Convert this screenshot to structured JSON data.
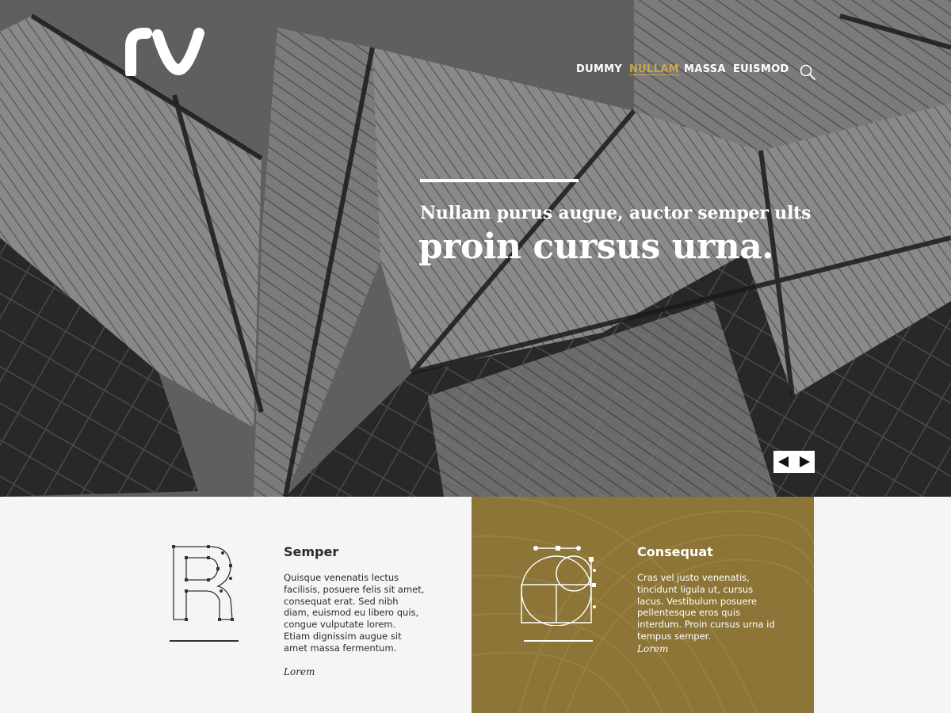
{
  "nav": {
    "items": [
      {
        "label": "DUMMY"
      },
      {
        "label": "NULLAM"
      },
      {
        "label": "MASSA"
      },
      {
        "label": "EUISMOD"
      }
    ],
    "active_index": 1,
    "search_icon": "search-icon"
  },
  "hero": {
    "subtitle": "Nullam purus augue, auctor semper ults",
    "title": "proin cursus urna."
  },
  "cards": [
    {
      "title": "Semper",
      "text": "Quisque venenatis lectus facilisis, posuere felis sit amet, consequat erat. Sed nibh diam, euismod eu libero quis, congue vulputate lorem. Etiam dignissim augue sit amet massa fermentum.",
      "link": "Lorem",
      "icon": "letter-r-glyph-icon"
    },
    {
      "title": "Consequat",
      "text": "Cras vel justo venenatis, tincidunt ligula ut, cursus lacus. Vestibulum posuere pellentesque eros quis interdum. Proin cursus urna id tempus semper.",
      "link": "Lorem",
      "icon": "letter-a-glyph-icon"
    }
  ],
  "colors": {
    "accent": "#c9a84a",
    "gold_panel": "#8c7536",
    "page_bg": "#f5f5f5"
  }
}
